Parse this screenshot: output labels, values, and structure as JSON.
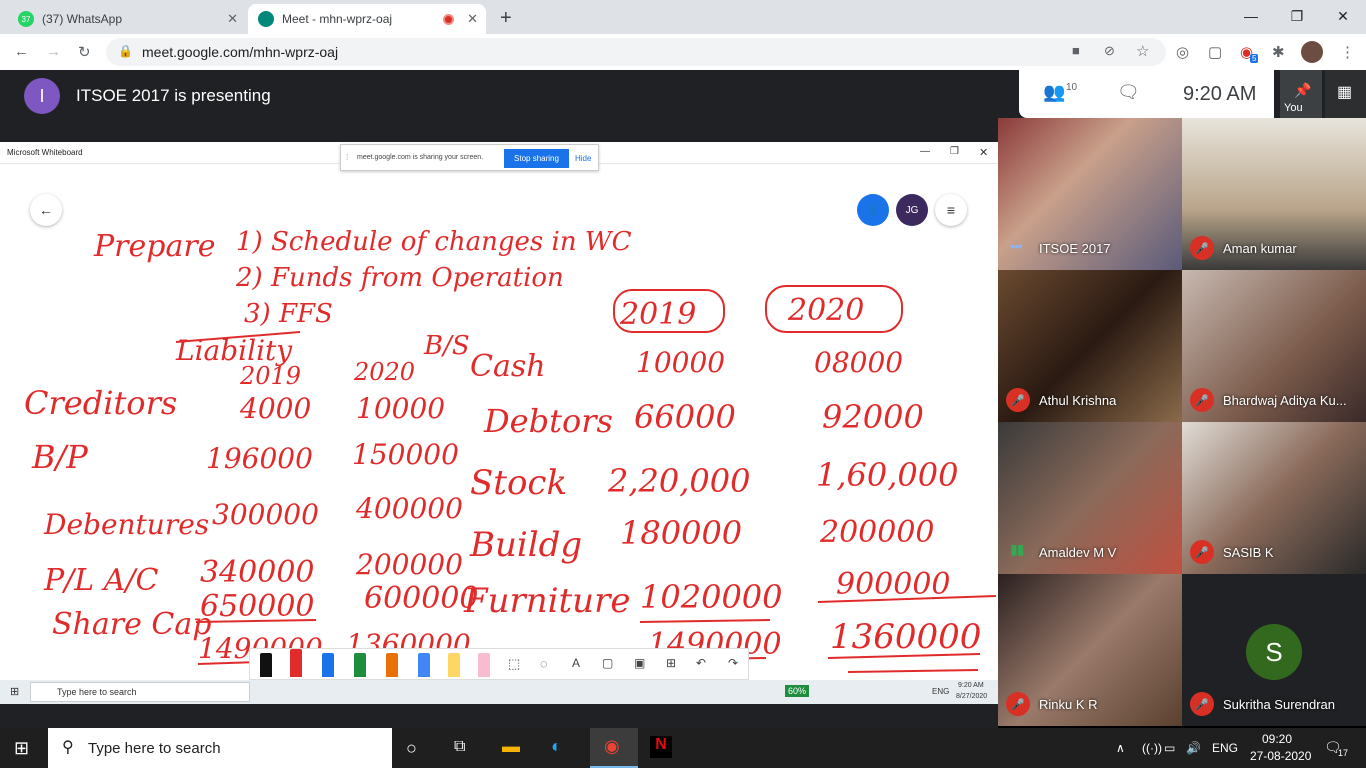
{
  "browser": {
    "tabs": [
      {
        "title": "(37) WhatsApp",
        "badge": "37"
      },
      {
        "title": "Meet - mhn-wprz-oaj"
      }
    ],
    "url": "meet.google.com/mhn-wprz-oaj",
    "extension_badge": "5"
  },
  "meet": {
    "presenter_initial": "I",
    "presenting_text": "ITSOE 2017 is presenting",
    "participant_count": "10",
    "clock": "9:20  AM",
    "self_label": "You"
  },
  "whiteboard": {
    "window_title": "Microsoft Whiteboard",
    "share_message": "meet.google.com is sharing your screen.",
    "stop_sharing": "Stop sharing",
    "hide": "Hide",
    "user_initials": "JG",
    "handwriting": {
      "heading": "Prepare",
      "item1": "1) Schedule of changes in WC",
      "item2": "2) Funds from Operation",
      "item3": "3) FFS",
      "liability": "Liability",
      "bs": "B/S",
      "col_2019": "2019",
      "col_2020": "2020",
      "year_2019": "2019",
      "year_2020": "2020",
      "rows_left": [
        {
          "label": "Creditors",
          "v2019": "4000",
          "v2020": "10000"
        },
        {
          "label": "B/P",
          "v2019": "196000",
          "v2020": "150000"
        },
        {
          "label": "Debentures",
          "v2019": "300000",
          "v2020": "400000"
        },
        {
          "label": "P/L A/C",
          "v2019": "340000",
          "v2020": "200000"
        },
        {
          "label": "Share Cap",
          "v2019": "650000",
          "v2020": "600000"
        }
      ],
      "total_left_2019": "1490000",
      "total_left_2020": "1360000",
      "rows_right": [
        {
          "label": "Cash",
          "v2019": "10000",
          "v2020": "08000"
        },
        {
          "label": "Debtors",
          "v2019": "66000",
          "v2020": "92000"
        },
        {
          "label": "Stock",
          "v2019": "2,20,000",
          "v2020": "1,60,000"
        },
        {
          "label": "Buildg",
          "v2019": "180000",
          "v2020": "200000"
        },
        {
          "label": "Furniture",
          "v2019": "1020000",
          "v2020": "900000"
        }
      ],
      "total_right_2019": "1490000",
      "total_right_2020": "1360000"
    },
    "inner_taskbar": {
      "search_placeholder": "Type here to search",
      "battery": "60%",
      "lang": "ENG",
      "time": "9:20 AM",
      "date": "8/27/2020"
    }
  },
  "participants": [
    {
      "name": "ITSOE 2017",
      "muted": false
    },
    {
      "name": "Aman kumar",
      "muted": true
    },
    {
      "name": "Athul Krishna",
      "muted": true
    },
    {
      "name": "Bhardwaj Aditya Ku...",
      "muted": true
    },
    {
      "name": "Amaldev M V",
      "muted": false
    },
    {
      "name": "SASIB K",
      "muted": true
    },
    {
      "name": "Rinku K R",
      "muted": true
    },
    {
      "name": "Sukritha Surendran",
      "muted": true,
      "initial": "S"
    }
  ],
  "taskbar": {
    "search_placeholder": "Type here to search",
    "lang": "ENG",
    "time": "09:20",
    "date": "27-08-2020",
    "notification_count": "17"
  }
}
